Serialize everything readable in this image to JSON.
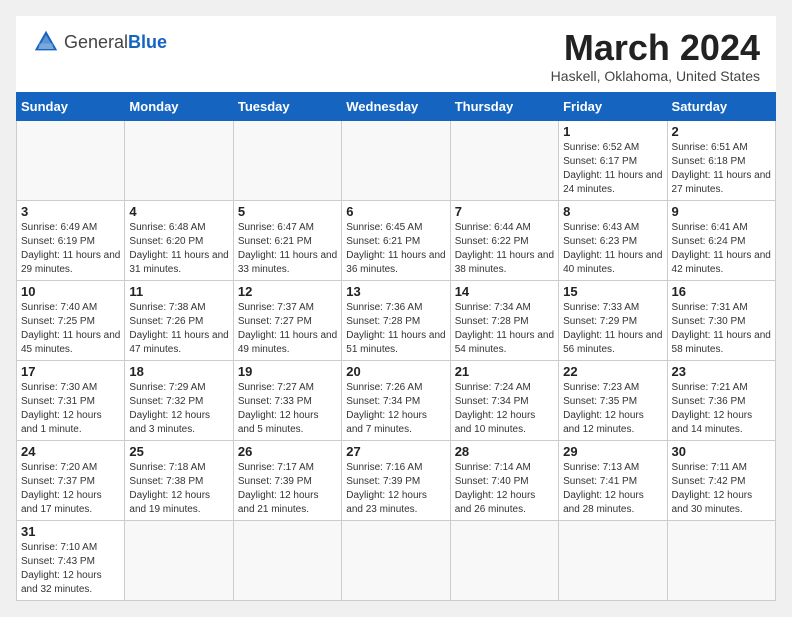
{
  "header": {
    "logo_general": "General",
    "logo_blue": "Blue",
    "month_title": "March 2024",
    "location": "Haskell, Oklahoma, United States"
  },
  "weekdays": [
    "Sunday",
    "Monday",
    "Tuesday",
    "Wednesday",
    "Thursday",
    "Friday",
    "Saturday"
  ],
  "weeks": [
    [
      {
        "day": "",
        "info": ""
      },
      {
        "day": "",
        "info": ""
      },
      {
        "day": "",
        "info": ""
      },
      {
        "day": "",
        "info": ""
      },
      {
        "day": "",
        "info": ""
      },
      {
        "day": "1",
        "info": "Sunrise: 6:52 AM\nSunset: 6:17 PM\nDaylight: 11 hours\nand 24 minutes."
      },
      {
        "day": "2",
        "info": "Sunrise: 6:51 AM\nSunset: 6:18 PM\nDaylight: 11 hours\nand 27 minutes."
      }
    ],
    [
      {
        "day": "3",
        "info": "Sunrise: 6:49 AM\nSunset: 6:19 PM\nDaylight: 11 hours\nand 29 minutes."
      },
      {
        "day": "4",
        "info": "Sunrise: 6:48 AM\nSunset: 6:20 PM\nDaylight: 11 hours\nand 31 minutes."
      },
      {
        "day": "5",
        "info": "Sunrise: 6:47 AM\nSunset: 6:21 PM\nDaylight: 11 hours\nand 33 minutes."
      },
      {
        "day": "6",
        "info": "Sunrise: 6:45 AM\nSunset: 6:21 PM\nDaylight: 11 hours\nand 36 minutes."
      },
      {
        "day": "7",
        "info": "Sunrise: 6:44 AM\nSunset: 6:22 PM\nDaylight: 11 hours\nand 38 minutes."
      },
      {
        "day": "8",
        "info": "Sunrise: 6:43 AM\nSunset: 6:23 PM\nDaylight: 11 hours\nand 40 minutes."
      },
      {
        "day": "9",
        "info": "Sunrise: 6:41 AM\nSunset: 6:24 PM\nDaylight: 11 hours\nand 42 minutes."
      }
    ],
    [
      {
        "day": "10",
        "info": "Sunrise: 7:40 AM\nSunset: 7:25 PM\nDaylight: 11 hours\nand 45 minutes."
      },
      {
        "day": "11",
        "info": "Sunrise: 7:38 AM\nSunset: 7:26 PM\nDaylight: 11 hours\nand 47 minutes."
      },
      {
        "day": "12",
        "info": "Sunrise: 7:37 AM\nSunset: 7:27 PM\nDaylight: 11 hours\nand 49 minutes."
      },
      {
        "day": "13",
        "info": "Sunrise: 7:36 AM\nSunset: 7:28 PM\nDaylight: 11 hours\nand 51 minutes."
      },
      {
        "day": "14",
        "info": "Sunrise: 7:34 AM\nSunset: 7:28 PM\nDaylight: 11 hours\nand 54 minutes."
      },
      {
        "day": "15",
        "info": "Sunrise: 7:33 AM\nSunset: 7:29 PM\nDaylight: 11 hours\nand 56 minutes."
      },
      {
        "day": "16",
        "info": "Sunrise: 7:31 AM\nSunset: 7:30 PM\nDaylight: 11 hours\nand 58 minutes."
      }
    ],
    [
      {
        "day": "17",
        "info": "Sunrise: 7:30 AM\nSunset: 7:31 PM\nDaylight: 12 hours\nand 1 minute."
      },
      {
        "day": "18",
        "info": "Sunrise: 7:29 AM\nSunset: 7:32 PM\nDaylight: 12 hours\nand 3 minutes."
      },
      {
        "day": "19",
        "info": "Sunrise: 7:27 AM\nSunset: 7:33 PM\nDaylight: 12 hours\nand 5 minutes."
      },
      {
        "day": "20",
        "info": "Sunrise: 7:26 AM\nSunset: 7:34 PM\nDaylight: 12 hours\nand 7 minutes."
      },
      {
        "day": "21",
        "info": "Sunrise: 7:24 AM\nSunset: 7:34 PM\nDaylight: 12 hours\nand 10 minutes."
      },
      {
        "day": "22",
        "info": "Sunrise: 7:23 AM\nSunset: 7:35 PM\nDaylight: 12 hours\nand 12 minutes."
      },
      {
        "day": "23",
        "info": "Sunrise: 7:21 AM\nSunset: 7:36 PM\nDaylight: 12 hours\nand 14 minutes."
      }
    ],
    [
      {
        "day": "24",
        "info": "Sunrise: 7:20 AM\nSunset: 7:37 PM\nDaylight: 12 hours\nand 17 minutes."
      },
      {
        "day": "25",
        "info": "Sunrise: 7:18 AM\nSunset: 7:38 PM\nDaylight: 12 hours\nand 19 minutes."
      },
      {
        "day": "26",
        "info": "Sunrise: 7:17 AM\nSunset: 7:39 PM\nDaylight: 12 hours\nand 21 minutes."
      },
      {
        "day": "27",
        "info": "Sunrise: 7:16 AM\nSunset: 7:39 PM\nDaylight: 12 hours\nand 23 minutes."
      },
      {
        "day": "28",
        "info": "Sunrise: 7:14 AM\nSunset: 7:40 PM\nDaylight: 12 hours\nand 26 minutes."
      },
      {
        "day": "29",
        "info": "Sunrise: 7:13 AM\nSunset: 7:41 PM\nDaylight: 12 hours\nand 28 minutes."
      },
      {
        "day": "30",
        "info": "Sunrise: 7:11 AM\nSunset: 7:42 PM\nDaylight: 12 hours\nand 30 minutes."
      }
    ],
    [
      {
        "day": "31",
        "info": "Sunrise: 7:10 AM\nSunset: 7:43 PM\nDaylight: 12 hours\nand 32 minutes."
      },
      {
        "day": "",
        "info": ""
      },
      {
        "day": "",
        "info": ""
      },
      {
        "day": "",
        "info": ""
      },
      {
        "day": "",
        "info": ""
      },
      {
        "day": "",
        "info": ""
      },
      {
        "day": "",
        "info": ""
      }
    ]
  ]
}
